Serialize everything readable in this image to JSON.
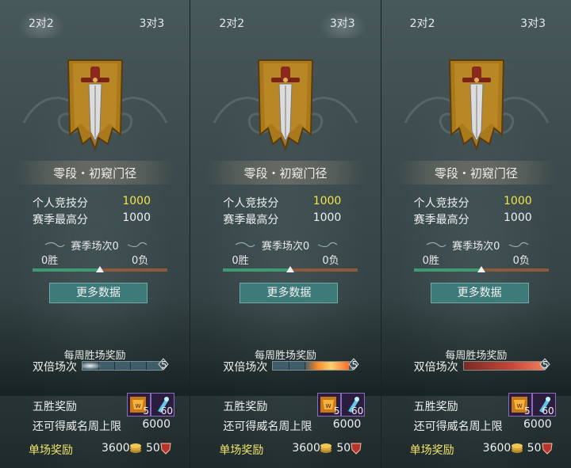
{
  "colors": {
    "panel_bg": "#3d4c4e",
    "score_highlight": "#f1e44a",
    "single_reward_label": "#f3e56a",
    "win_bar": "#3e9a72",
    "loss_bar": "#8b5a3c",
    "button_bg": "#3f7a7a",
    "item_border": "#8a6bc2"
  },
  "panels": [
    {
      "tabs": [
        "2对2",
        "3对3"
      ],
      "emblem_icon": "sword-banner-icon",
      "rank_title": "零段・初窥门径",
      "stats": {
        "personal_score_label": "个人竞技分",
        "personal_score_value": "1000",
        "season_best_label": "赛季最高分",
        "season_best_value": "1000"
      },
      "season": {
        "title": "赛季场次0",
        "wins": "0胜",
        "losses": "0负",
        "win_ratio": 0.5
      },
      "more_button": "更多数据",
      "weekly": {
        "title": "每周胜场奖励",
        "double_label": "双倍场次",
        "double_count": "5",
        "fill_style": "empty"
      },
      "five_win": {
        "label": "五胜奖励",
        "items": [
          {
            "icon": "honor-token-icon",
            "count": "5"
          },
          {
            "icon": "crystal-key-icon",
            "count": "60"
          }
        ]
      },
      "remain": {
        "label": "还可得威名周上限",
        "value": "6000"
      },
      "single": {
        "label": "单场奖励",
        "coin_value": "3600",
        "coin_icon": "coin-stack-icon",
        "shield_value": "50",
        "shield_icon": "red-shield-icon"
      }
    },
    {
      "tabs": [
        "2对2",
        "3对3"
      ],
      "emblem_icon": "sword-banner-icon",
      "rank_title": "零段・初窥门径",
      "stats": {
        "personal_score_label": "个人竞技分",
        "personal_score_value": "1000",
        "season_best_label": "赛季最高分",
        "season_best_value": "1000"
      },
      "season": {
        "title": "赛季场次0",
        "wins": "0胜",
        "losses": "0负",
        "win_ratio": 0.5
      },
      "more_button": "更多数据",
      "weekly": {
        "title": "每周胜场奖励",
        "double_label": "双倍场次",
        "double_count": "5",
        "fill_style": "flame"
      },
      "five_win": {
        "label": "五胜奖励",
        "items": [
          {
            "icon": "honor-token-icon",
            "count": "5"
          },
          {
            "icon": "crystal-key-icon",
            "count": "60"
          }
        ]
      },
      "remain": {
        "label": "还可得威名周上限",
        "value": "6000"
      },
      "single": {
        "label": "单场奖励",
        "coin_value": "3600",
        "coin_icon": "coin-stack-icon",
        "shield_value": "50",
        "shield_icon": "red-shield-icon"
      }
    },
    {
      "tabs": [
        "2对2",
        "3对3"
      ],
      "emblem_icon": "sword-banner-icon",
      "rank_title": "零段・初窥门径",
      "stats": {
        "personal_score_label": "个人竞技分",
        "personal_score_value": "1000",
        "season_best_label": "赛季最高分",
        "season_best_value": "1000"
      },
      "season": {
        "title": "赛季场次0",
        "wins": "0胜",
        "losses": "0负",
        "win_ratio": 0.5
      },
      "more_button": "更多数据",
      "weekly": {
        "title": "每周胜场奖励",
        "double_label": "双倍场次",
        "double_count": "5",
        "fill_style": "full"
      },
      "five_win": {
        "label": "五胜奖励",
        "items": [
          {
            "icon": "honor-token-icon",
            "count": "5"
          },
          {
            "icon": "crystal-key-icon",
            "count": "60"
          }
        ]
      },
      "remain": {
        "label": "还可得威名周上限",
        "value": "6000"
      },
      "single": {
        "label": "单场奖励",
        "coin_value": "3600",
        "coin_icon": "coin-stack-icon",
        "shield_value": "50",
        "shield_icon": "red-shield-icon"
      }
    }
  ]
}
